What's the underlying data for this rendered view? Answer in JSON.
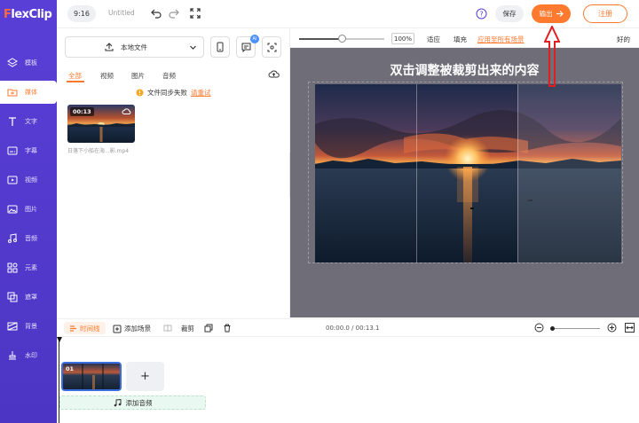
{
  "app": {
    "logo_prefix": "F",
    "logo_rest": "lexClip"
  },
  "sidebar": {
    "items": [
      {
        "label": "模板",
        "icon": "layers-icon"
      },
      {
        "label": "媒体",
        "icon": "folder-icon",
        "active": true
      },
      {
        "label": "文字",
        "icon": "text-icon"
      },
      {
        "label": "字幕",
        "icon": "subtitle-icon"
      },
      {
        "label": "视频",
        "icon": "video-icon"
      },
      {
        "label": "图片",
        "icon": "image-icon"
      },
      {
        "label": "音频",
        "icon": "music-icon"
      },
      {
        "label": "元素",
        "icon": "shapes-icon"
      },
      {
        "label": "遮罩",
        "icon": "mask-icon"
      },
      {
        "label": "背景",
        "icon": "background-icon"
      },
      {
        "label": "水印",
        "icon": "watermark-icon"
      }
    ]
  },
  "topbar": {
    "aspect_ratio": "9:16",
    "project_title": "Untitled",
    "save_label": "保存",
    "export_label": "输出",
    "register_label": "注册"
  },
  "media": {
    "local_file_label": "本地文件",
    "ai_badge": "AI",
    "tabs": [
      "全部",
      "视频",
      "图片",
      "音频"
    ],
    "active_tab": "全部",
    "sync_warning": "文件同步失败",
    "retry_label": "请重试",
    "items": [
      {
        "duration": "00:13",
        "filename": "日落下小船在海...影.mp4"
      }
    ]
  },
  "preview_toolbar": {
    "zoom_level": "100%",
    "zoom_fraction": 0.5,
    "fit_label": "适应",
    "fill_label": "填充",
    "apply_all_label": "应用至所有场景",
    "ok_label": "好的"
  },
  "stage": {
    "crop_hint": "双击调整被裁剪出来的内容"
  },
  "timeline_toolbar": {
    "timeline_label": "时间线",
    "add_scene_label": "添加场景",
    "crop_label": "裁剪",
    "timecode": "00:00.0 / 00:13.1"
  },
  "timeline": {
    "clips": [
      {
        "index": "01"
      }
    ],
    "add_scene_symbol": "+",
    "add_audio_label": "添加音频"
  },
  "colors": {
    "accent": "#ff7a2f",
    "sidebar": "#5a3fd6",
    "stage_bg": "#6f6e78",
    "annotation": "#e02020"
  }
}
